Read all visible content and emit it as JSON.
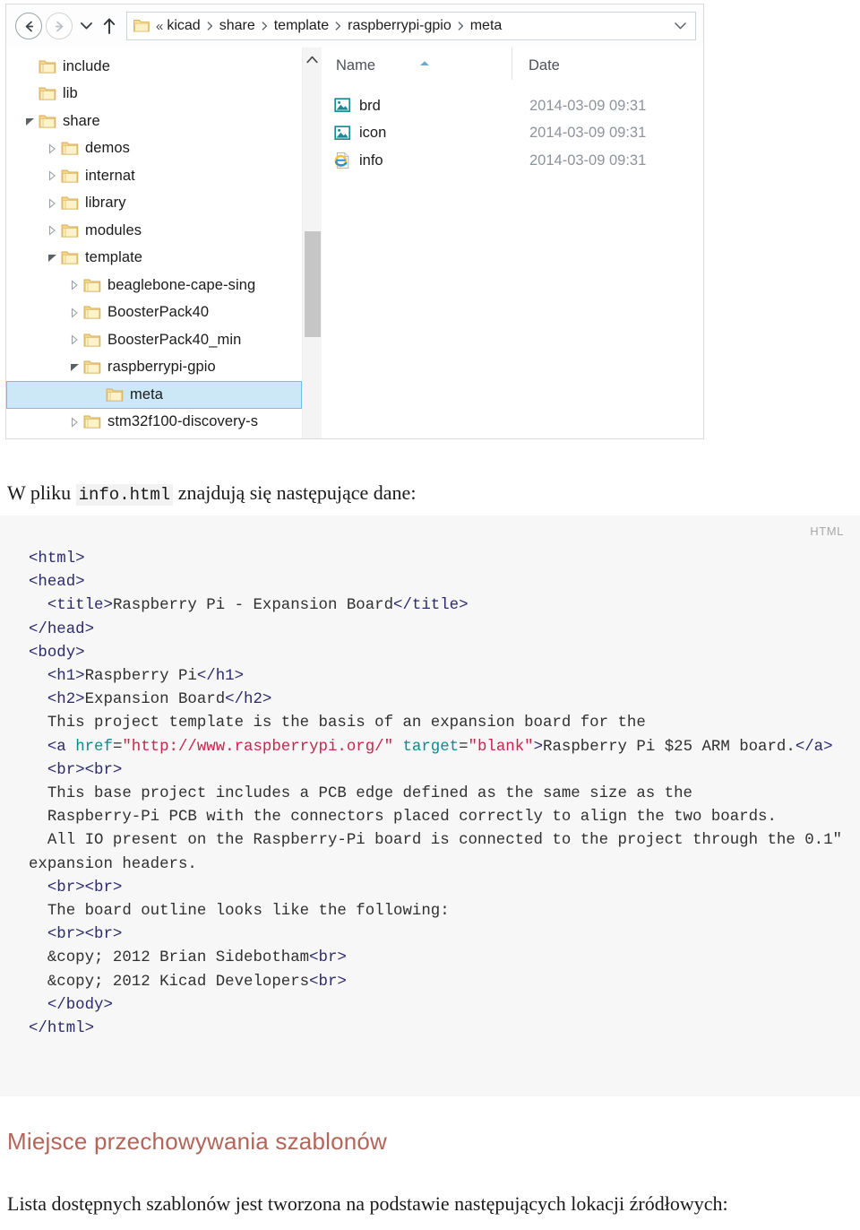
{
  "explorer": {
    "nav": {
      "back_label": "Back",
      "forward_label": "Forward",
      "recent_label": "Recent locations",
      "up_label": "Up one level"
    },
    "breadcrumb": {
      "overflow": "«",
      "dropdown": "v",
      "items": [
        "kicad",
        "share",
        "template",
        "raspberrypi-gpio",
        "meta"
      ]
    },
    "tree": [
      {
        "label": "include",
        "depth": 1,
        "expander": "none",
        "selected": false
      },
      {
        "label": "lib",
        "depth": 1,
        "expander": "none",
        "selected": false
      },
      {
        "label": "share",
        "depth": 1,
        "expander": "open",
        "selected": false
      },
      {
        "label": "demos",
        "depth": 2,
        "expander": "closed",
        "selected": false
      },
      {
        "label": "internat",
        "depth": 2,
        "expander": "closed",
        "selected": false
      },
      {
        "label": "library",
        "depth": 2,
        "expander": "closed",
        "selected": false
      },
      {
        "label": "modules",
        "depth": 2,
        "expander": "closed",
        "selected": false
      },
      {
        "label": "template",
        "depth": 2,
        "expander": "open",
        "selected": false
      },
      {
        "label": "beaglebone-cape-sing",
        "depth": 3,
        "expander": "closed",
        "selected": false
      },
      {
        "label": "BoosterPack40",
        "depth": 3,
        "expander": "closed",
        "selected": false
      },
      {
        "label": "BoosterPack40_min",
        "depth": 3,
        "expander": "closed",
        "selected": false
      },
      {
        "label": "raspberrypi-gpio",
        "depth": 3,
        "expander": "open",
        "selected": false
      },
      {
        "label": "meta",
        "depth": 4,
        "expander": "none",
        "selected": true
      },
      {
        "label": "stm32f100-discovery-s",
        "depth": 3,
        "expander": "closed",
        "selected": false
      }
    ],
    "columns": {
      "name": "Name",
      "date": "Date"
    },
    "files": [
      {
        "name": "brd",
        "date": "2014-03-09 09:31",
        "icon": "image-file-icon"
      },
      {
        "name": "icon",
        "date": "2014-03-09 09:31",
        "icon": "image-file-icon"
      },
      {
        "name": "info",
        "date": "2014-03-09 09:31",
        "icon": "html-file-icon"
      }
    ]
  },
  "intro": {
    "before": "W pliku ",
    "code": "info.html",
    "after": " znajdują się następujące dane:"
  },
  "code_block": {
    "language_badge": "HTML",
    "lines": [
      {
        "t": "tg",
        "v": "<html>"
      },
      {
        "t": "tg",
        "v": "<head>"
      },
      {
        "t": "mix-title",
        "indent": 2
      },
      {
        "t": "tg",
        "v": "</head>"
      },
      {
        "t": "tg",
        "v": "<body>"
      },
      {
        "t": "mix-h1",
        "indent": 2
      },
      {
        "t": "mix-h2",
        "indent": 2
      },
      {
        "t": "tx",
        "v": "This project template is the basis of an expansion board for the",
        "indent": 2
      },
      {
        "t": "mix-anchor",
        "indent": 2
      },
      {
        "t": "tg",
        "v": "<br><br>",
        "indent": 2
      },
      {
        "t": "tx",
        "v": "This base project includes a PCB edge defined as the same size as the",
        "indent": 2
      },
      {
        "t": "tx",
        "v": "Raspberry-Pi PCB with the connectors placed correctly to align the two boards.",
        "indent": 2
      },
      {
        "t": "tx",
        "v": "All IO present on the Raspberry-Pi board is connected to the project through the 0.1\" expansion headers.",
        "indent": 2
      },
      {
        "t": "tg",
        "v": "<br><br>",
        "indent": 2
      },
      {
        "t": "tx",
        "v": "The board outline looks like the following:",
        "indent": 2
      },
      {
        "t": "tg",
        "v": "<br><br>",
        "indent": 2
      },
      {
        "t": "mix-copy1",
        "indent": 2
      },
      {
        "t": "mix-copy2",
        "indent": 2
      },
      {
        "t": "tg",
        "v": "</body>",
        "indent": 2
      },
      {
        "t": "tg",
        "v": "</html>"
      }
    ],
    "tokens": {
      "title_open": "<title>",
      "title_text": "Raspberry Pi - Expansion Board",
      "title_close": "</title>",
      "h1_open": "<h1>",
      "h1_text": "Raspberry Pi",
      "h1_close": "</h1>",
      "h2_open": "<h2>",
      "h2_text": "Expansion Board",
      "h2_close": "</h2>",
      "a_open": "<a ",
      "a_attr_href": "href",
      "a_href_value": "\"http://www.raspberrypi.org/\"",
      "a_attr_target": "target",
      "a_target_value": "\"blank\"",
      "a_gt": ">",
      "a_text": "Raspberry Pi $25 ARM board.",
      "a_close": "</a>",
      "copy_entity": "&copy;",
      "copy1_text": " 2012 Brian Sidebotham",
      "copy2_text": " 2012 Kicad Developers",
      "br_tag": "<br>"
    }
  },
  "section": {
    "heading": "Miejsce przechowywania szablonów",
    "paragraph": "Lista dostępnych szablonów jest tworzona na podstawie następujących lokacji źródłowych:"
  },
  "colors": {
    "tag": "#2b2b6b",
    "attribute": "#0f8a8a",
    "string": "#c7254e",
    "heading": "#b5645a",
    "selection": "#cce8f6",
    "code_bg": "#f7f7f7"
  }
}
